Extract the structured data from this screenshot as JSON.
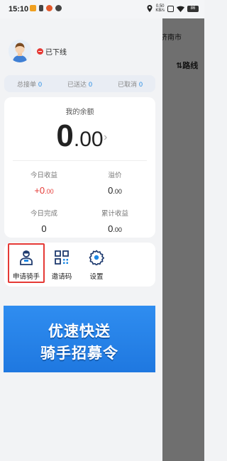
{
  "statusbar": {
    "time": "15:10",
    "speed_top": "0.50",
    "speed_bottom": "KB/s",
    "battery": "86"
  },
  "overlay": {
    "city": "济南市",
    "route_label": "路线"
  },
  "profile": {
    "status": "已下线"
  },
  "stats": [
    {
      "label": "总接单",
      "value": "0"
    },
    {
      "label": "已送达",
      "value": "0"
    },
    {
      "label": "已取消",
      "value": "0"
    }
  ],
  "balance": {
    "title": "我的余额",
    "integer": "0",
    "decimal": ".00"
  },
  "metrics": {
    "today_income": {
      "label": "今日收益",
      "prefix": "+0",
      "decimal": ".00"
    },
    "premium": {
      "label": "溢价",
      "prefix": "0",
      "decimal": ".00"
    },
    "today_done": {
      "label": "今日完成",
      "value": "0"
    },
    "total_income": {
      "label": "累计收益",
      "prefix": "0",
      "decimal": ".00"
    }
  },
  "actions": [
    {
      "label": "申请骑手",
      "icon": "rider-icon"
    },
    {
      "label": "邀请码",
      "icon": "qr-code-icon"
    },
    {
      "label": "设置",
      "icon": "gear-icon"
    }
  ],
  "banner": {
    "line1": "优速快送",
    "line2": "骑手招募令"
  },
  "colors": {
    "accent_blue": "#1e88e5",
    "offline_red": "#e53935",
    "highlight_red": "#e53935",
    "banner_blue": "#2f8df0"
  }
}
